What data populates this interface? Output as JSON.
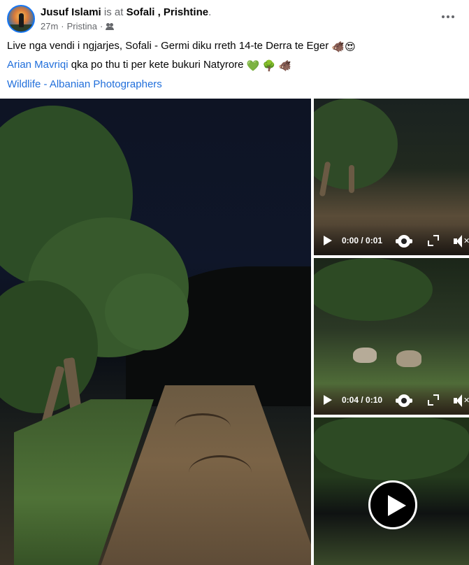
{
  "post": {
    "author": "Jusuf Islami",
    "is_at": " is at ",
    "location": "Sofali , Prishtine",
    "period": ".",
    "time": "27m",
    "separator1": "·",
    "place": "Pristina",
    "separator2": "·",
    "audience_icon": "friends-icon",
    "more_icon": "more-options-icon"
  },
  "body": {
    "line1_text": "Live nga vendi i ngjarjes, Sofali - Germi diku rreth 14-te Derra te Eger ",
    "line1_emoji1": "🐗",
    "line1_emoji2": "😍",
    "line2_mention": "Arian Mavriqi",
    "line2_text": " qka po thu ti per kete bukuri Natyrore ",
    "line2_emoji1": "💚",
    "line2_emoji2": "🌳",
    "line2_emoji3": "🐗",
    "line3_link": "Wildlife - Albanian Photographers"
  },
  "media": {
    "videos": [
      {
        "time": "0:00 / 0:01"
      },
      {
        "time": "0:04 / 0:10"
      }
    ],
    "play_icon": "play-icon",
    "settings_icon": "gear-icon",
    "fullscreen_icon": "fullscreen-icon",
    "volume_icon": "mute-icon",
    "mute_glyph": "✕"
  }
}
